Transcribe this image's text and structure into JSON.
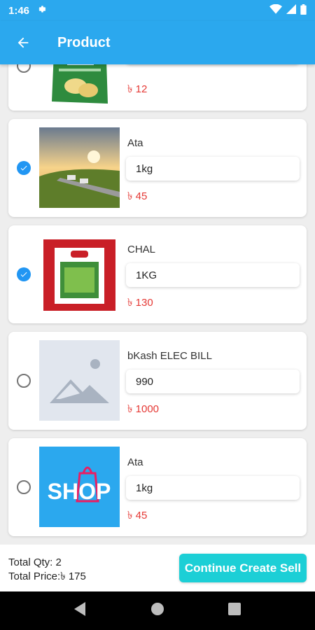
{
  "status_bar": {
    "time": "1:46"
  },
  "app_bar": {
    "title": "Product"
  },
  "products": [
    {
      "name": "",
      "qty": "",
      "price": "৳ 12",
      "checked": false
    },
    {
      "name": "Ata",
      "qty": "1kg",
      "price": "৳ 45",
      "checked": true
    },
    {
      "name": "CHAL",
      "qty": "1KG",
      "price": "৳ 130",
      "checked": true
    },
    {
      "name": "bKash ELEC BILL",
      "qty": "990",
      "price": "৳ 1000",
      "checked": false
    },
    {
      "name": "Ata",
      "qty": "1kg",
      "price": "৳ 45",
      "checked": false
    }
  ],
  "images": {
    "shop_logo_text": "SHOP"
  },
  "footer": {
    "total_qty": "Total Qty: 2",
    "total_price": "Total Price:৳ 175",
    "continue_label": "Continue Create Sell"
  },
  "colors": {
    "primary": "#2ba8ee",
    "accent": "#1ccfd6",
    "price": "#e53935",
    "check": "#2196f3"
  }
}
